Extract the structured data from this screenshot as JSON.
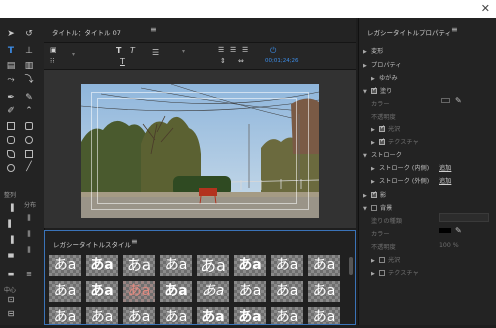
{
  "window": {
    "close_glyph": "✕"
  },
  "tools": {
    "align_label": "整列",
    "distribute_label": "分布",
    "center_label": "中心"
  },
  "center_panel": {
    "title": "タイトル：タイトル 07",
    "menu_glyph": "≡",
    "timecode": "00;01;24;26"
  },
  "styles_panel": {
    "title": "レガシータイトルスタイル",
    "menu_glyph": "≡",
    "swatch_text": "あa",
    "highlight_color": "#e08a80"
  },
  "properties_panel": {
    "title": "レガシータイトルプロパティ",
    "menu_glyph": "≡",
    "transform": "変形",
    "properties": "プロパティ",
    "distort": "ゆがみ",
    "fill": "塗り",
    "color": "カラー",
    "opacity": "不透明度",
    "sheen": "光沢",
    "texture": "テクスチャ",
    "strokes": "ストローク",
    "inner_stroke_1": "ストローク (内側)",
    "outer_stroke_1": "ストローク (外側)",
    "add": "追加",
    "shadow": "影",
    "background": "背景",
    "fill_type": "塗りの種類",
    "bg_color": "カラー",
    "bg_opacity": "不透明度",
    "bg_opacity_value": "100 %",
    "bg_sheen": "光沢",
    "bg_texture": "テクスチャ"
  }
}
